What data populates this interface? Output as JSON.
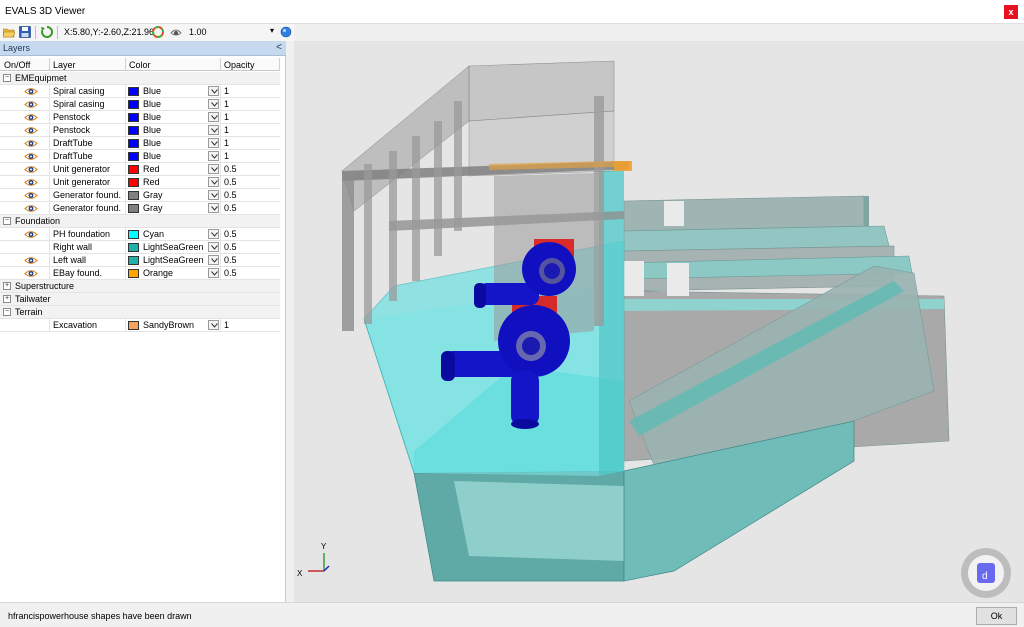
{
  "window": {
    "title": "EVALS 3D Viewer",
    "close_label": "x"
  },
  "toolbar": {
    "icons": [
      "open-folder-icon",
      "save-icon",
      "refresh-icon",
      "color-wheel-icon",
      "eye-settings-icon",
      "view-cube-icon"
    ],
    "coords": "X:5.80,Y:-2.60,Z:21.96",
    "zoom_value": "1.00"
  },
  "layers_panel": {
    "title": "Layers",
    "collapse_glyph": "<",
    "columns": [
      "On/Off",
      "Layer",
      "Color",
      "Opacity"
    ],
    "groups": [
      {
        "name": "EMEquipmet",
        "expander": "−",
        "layers": [
          {
            "visible": true,
            "name": "Spiral casing",
            "color_name": "Blue",
            "color": "#0000ff",
            "opacity": "1"
          },
          {
            "visible": true,
            "name": "Spiral casing",
            "color_name": "Blue",
            "color": "#0000ff",
            "opacity": "1"
          },
          {
            "visible": true,
            "name": "Penstock",
            "color_name": "Blue",
            "color": "#0000ff",
            "opacity": "1"
          },
          {
            "visible": true,
            "name": "Penstock",
            "color_name": "Blue",
            "color": "#0000ff",
            "opacity": "1"
          },
          {
            "visible": true,
            "name": "DraftTube",
            "color_name": "Blue",
            "color": "#0000ff",
            "opacity": "1"
          },
          {
            "visible": true,
            "name": "DraftTube",
            "color_name": "Blue",
            "color": "#0000ff",
            "opacity": "1"
          },
          {
            "visible": true,
            "name": "Unit generator",
            "color_name": "Red",
            "color": "#ff0000",
            "opacity": "0.5"
          },
          {
            "visible": true,
            "name": "Unit generator",
            "color_name": "Red",
            "color": "#ff0000",
            "opacity": "0.5"
          },
          {
            "visible": true,
            "name": "Generator found.",
            "color_name": "Gray",
            "color": "#808080",
            "opacity": "0.5"
          },
          {
            "visible": true,
            "name": "Generator found.",
            "color_name": "Gray",
            "color": "#808080",
            "opacity": "0.5"
          }
        ]
      },
      {
        "name": "Foundation",
        "expander": "−",
        "layers": [
          {
            "visible": true,
            "name": "PH foundation",
            "color_name": "Cyan",
            "color": "#00ffff",
            "opacity": "0.5"
          },
          {
            "visible": false,
            "name": "Right wall",
            "color_name": "LightSeaGreen",
            "color": "#20b2aa",
            "opacity": "0.5"
          },
          {
            "visible": true,
            "name": "Left wall",
            "color_name": "LightSeaGreen",
            "color": "#20b2aa",
            "opacity": "0.5"
          },
          {
            "visible": true,
            "name": "EBay found.",
            "color_name": "Orange",
            "color": "#ffa500",
            "opacity": "0.5"
          }
        ]
      },
      {
        "name": "Superstructure",
        "expander": "+",
        "layers": []
      },
      {
        "name": "Tailwater",
        "expander": "+",
        "layers": []
      },
      {
        "name": "Terrain",
        "expander": "−",
        "layers": [
          {
            "visible": false,
            "name": "Excavation",
            "color_name": "SandyBrown",
            "color": "#f4a460",
            "opacity": "1"
          }
        ]
      }
    ]
  },
  "viewport": {
    "axis_labels": {
      "x": "X",
      "y": "Y"
    },
    "colors": {
      "background": "#e5e5e5",
      "cyan": "#3fdcdc",
      "teal": "#2aa5a0",
      "blue": "#0a0ad0",
      "red": "#e01010",
      "gray": "#8c8c8c",
      "orange": "#f0a030"
    }
  },
  "status": {
    "message": "hfrancispowerhouse shapes have been drawn",
    "ok_label": "Ok"
  }
}
